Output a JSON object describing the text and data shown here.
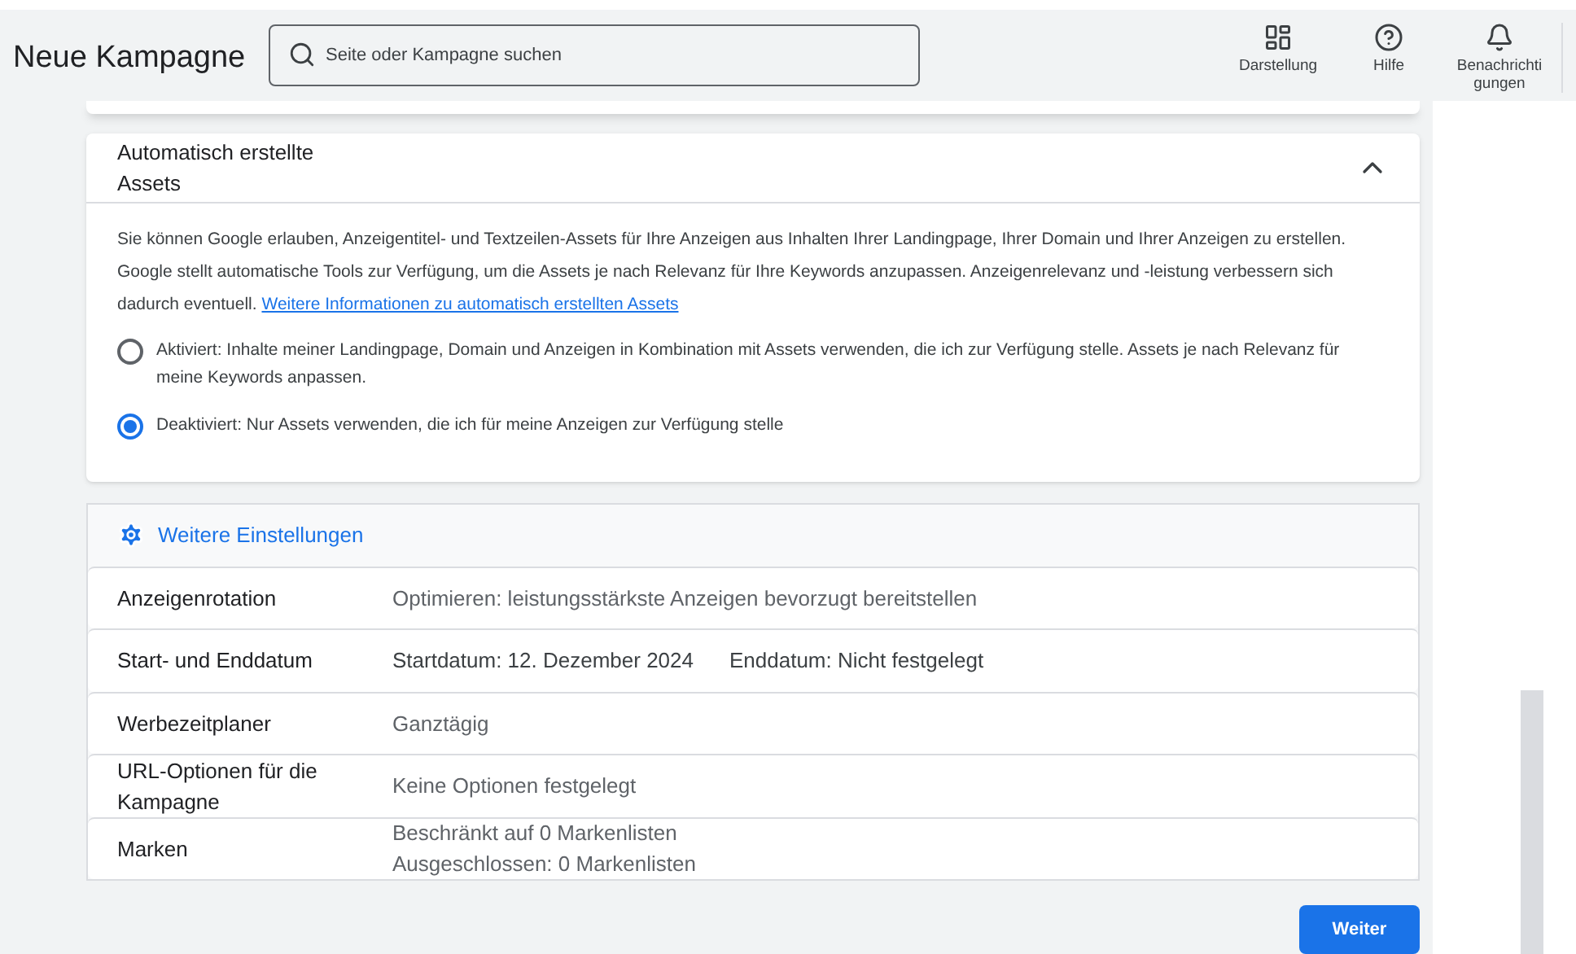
{
  "header": {
    "title": "Neue Kampagne",
    "search": {
      "placeholder": "Seite oder Kampagne suchen"
    },
    "actions": [
      {
        "kind": "display",
        "label": "Darstellung"
      },
      {
        "kind": "help",
        "label": "Hilfe"
      },
      {
        "kind": "bell",
        "label": "Benachrichti gungen"
      }
    ]
  },
  "assets_panel": {
    "title": "Automatisch erstellte Assets",
    "expanded": true,
    "description": "Sie können Google erlauben, Anzeigentitel- und Textzeilen-Assets für Ihre Anzeigen aus Inhalten Ihrer Landingpage, Ihrer Domain und Ihrer Anzeigen zu erstellen. Google stellt automatische Tools zur Verfügung, um die Assets je nach Relevanz für Ihre Keywords anzupassen. Anzeigenrelevanz und -leistung verbessern sich dadurch eventuell.",
    "link": "Weitere Informationen zu automatisch erstellten Assets",
    "options": [
      {
        "label": "Aktiviert: Inhalte meiner Landingpage, Domain und Anzeigen in Kombination mit Assets verwenden, die ich zur Verfügung stelle. Assets je nach Relevanz für meine Keywords anpassen.",
        "selected": false
      },
      {
        "label": "Deaktiviert: Nur Assets verwenden, die ich für meine Anzeigen zur Verfügung stelle",
        "selected": true
      }
    ]
  },
  "more_settings": {
    "title": "Weitere Einstellungen",
    "rows": [
      {
        "label": "Anzeigenrotation",
        "values": [
          "Optimieren: leistungsstärkste Anzeigen bevorzugt bereitstellen"
        ],
        "emphasis": false
      },
      {
        "label": "Start- und Enddatum",
        "values": [
          "Startdatum: 12. Dezember 2024",
          "Enddatum: Nicht festgelegt"
        ],
        "emphasis": true
      },
      {
        "label": "Werbezeitplaner",
        "values": [
          "Ganztägig"
        ],
        "emphasis": false
      },
      {
        "label": "URL-Optionen für die Kampagne",
        "values": [
          "Keine Optionen festgelegt"
        ],
        "emphasis": false
      },
      {
        "label": "Marken",
        "values": [
          "Beschränkt auf 0 Markenlisten",
          "Ausgeschlossen: 0 Markenlisten"
        ],
        "emphasis": false
      }
    ]
  },
  "next_button": "Weiter"
}
